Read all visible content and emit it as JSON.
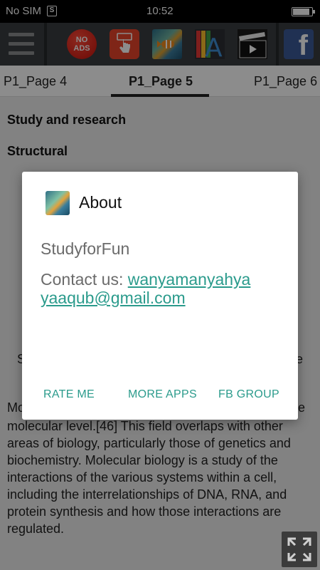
{
  "status_bar": {
    "carrier": "No SIM",
    "sim_badge": "S",
    "time": "10:52",
    "battery_level": 0.9
  },
  "toolbar": {
    "noads_label": "NO ADS",
    "icons": [
      "menu-icon",
      "no-ads-icon",
      "touch-icon",
      "fish-icon",
      "font-icon",
      "movie-icon",
      "facebook-icon"
    ],
    "facebook_glyph": "f",
    "font_glyph": "A"
  },
  "tabs": [
    {
      "label": "P1_Page 4"
    },
    {
      "label": "P1_Page 5",
      "active": true
    },
    {
      "label": "P1_Page 6"
    }
  ],
  "content": {
    "heading1": "Study and research",
    "heading2": "Structural",
    "left_fragment": "S",
    "right_fragment": "e",
    "para_fragment_left": "Mo",
    "para_fragment_right": "e",
    "paragraph": "molecular level.[46] This field overlaps with other areas of biology, particularly those of genetics and biochemistry. Molecular biology is a study of the interactions of the various systems within a cell, including the interrelationships of DNA, RNA, and protein synthesis and how those interactions are regulated."
  },
  "dialog": {
    "title": "About",
    "app_name": "StudyforFun",
    "contact_prefix": "Contact us: ",
    "email": "wanyamanyahyayaaqub@gmail.com",
    "buttons": [
      "RATE ME",
      "MORE APPS",
      "FB GROUP"
    ]
  },
  "colors": {
    "accent": "#2b9b8c",
    "toolbar_bg": "#3a3d40",
    "facebook_blue": "#3b5998"
  }
}
